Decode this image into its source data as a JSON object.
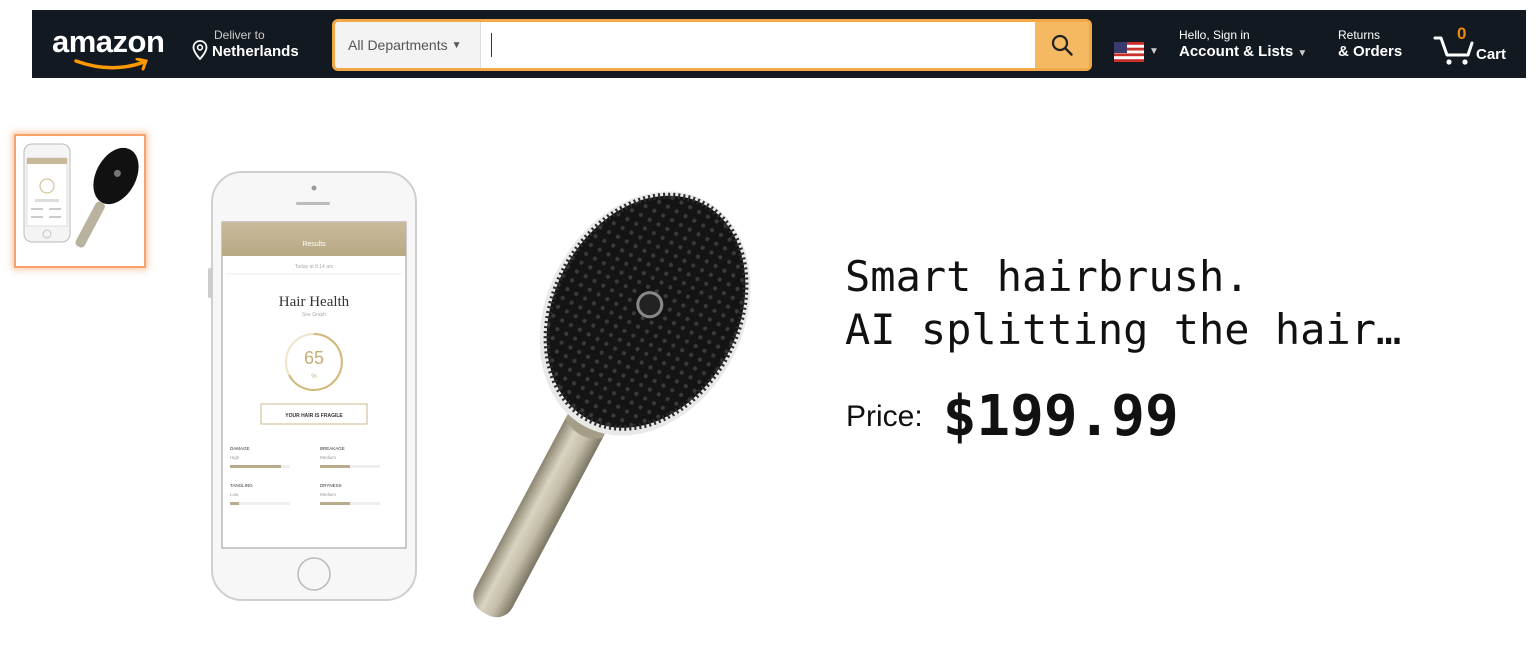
{
  "header": {
    "logo_text": "amazon",
    "deliver_small": "Deliver to",
    "deliver_big": "Netherlands",
    "search": {
      "department": "All Departments",
      "placeholder": ""
    },
    "account_small": "Hello, Sign in",
    "account_big": "Account & Lists",
    "returns_small": "Returns",
    "returns_big": "& Orders",
    "cart_count": "0",
    "cart_label": "Cart"
  },
  "product": {
    "title_line1": "Smart hairbrush.",
    "title_line2": "AI splitting the hair…",
    "price_label": "Price:",
    "price_value": "$199.99"
  },
  "phone_screen": {
    "header": "Results",
    "date": "Today at 8:14 am",
    "heading": "Hair Health",
    "subheading": "See Graph",
    "score": "65",
    "score_unit": "%",
    "status": "YOUR HAIR IS FRAGILE",
    "metrics": [
      {
        "name": "DAMAGE",
        "level": "High",
        "fill": 0.85
      },
      {
        "name": "BREAKAGE",
        "level": "Medium",
        "fill": 0.5
      },
      {
        "name": "TANGLING",
        "level": "Low",
        "fill": 0.15
      },
      {
        "name": "DRYNESS",
        "level": "Medium",
        "fill": 0.5
      }
    ]
  },
  "colors": {
    "nav_bg": "#131921",
    "search_border": "#f3a847",
    "search_button": "#f5b963",
    "cart_count": "#f08804",
    "thumb_highlight": "#f7a26a"
  }
}
